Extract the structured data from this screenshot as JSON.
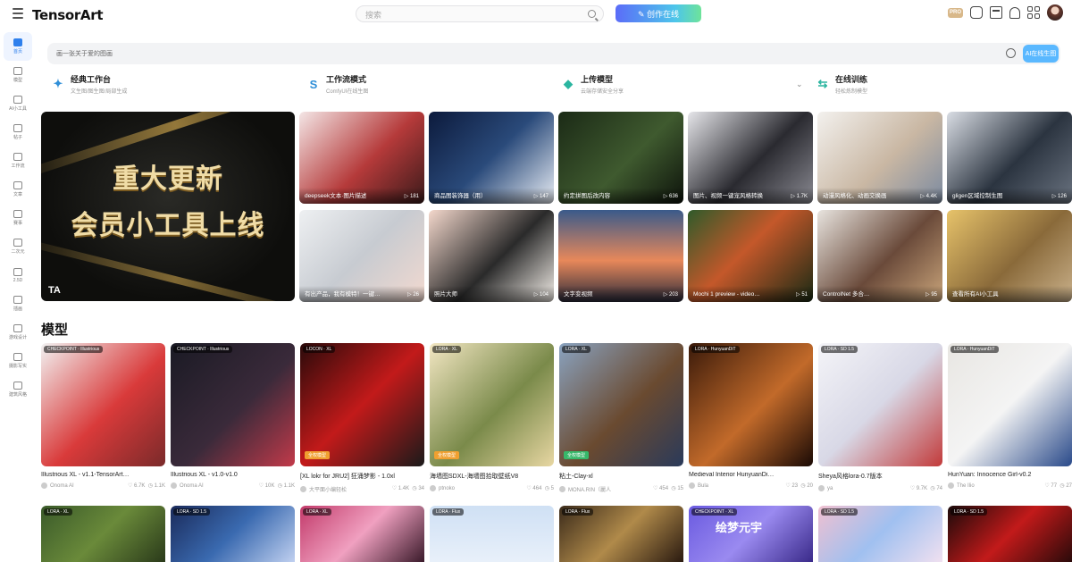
{
  "header": {
    "logo": "TensorArt",
    "search_placeholder": "搜索",
    "create_label": "✎ 创作在线",
    "pro_label": "PRO"
  },
  "sidebar": {
    "items": [
      {
        "label": "首页",
        "icon": "home-icon",
        "active": true
      },
      {
        "label": "模型",
        "icon": "model-icon"
      },
      {
        "label": "AI小工具",
        "icon": "ai-tools-icon"
      },
      {
        "label": "帖子",
        "icon": "post-icon"
      },
      {
        "label": "工作流",
        "icon": "workflow-icon"
      },
      {
        "label": "文章",
        "icon": "article-icon"
      },
      {
        "label": "赛事",
        "icon": "contest-icon"
      },
      {
        "label": "二次元",
        "icon": "anime-icon"
      },
      {
        "label": "2.5D",
        "icon": "2-5d-icon"
      },
      {
        "label": "插画",
        "icon": "illustration-icon"
      },
      {
        "label": "游戏设计",
        "icon": "game-design-icon"
      },
      {
        "label": "摄影写实",
        "icon": "photo-icon"
      },
      {
        "label": "建筑风格",
        "icon": "architecture-icon"
      }
    ]
  },
  "prompt": {
    "placeholder": "画一张关于爱的图画",
    "generate_label": "AI在线生图"
  },
  "tools": [
    {
      "title": "经典工作台",
      "sub": "文生图/图生图/局部生成",
      "icon": "wand-icon"
    },
    {
      "title": "工作流模式",
      "sub": "ComfyUI在线生图",
      "icon": "workflow-s-icon"
    },
    {
      "title": "上传模型",
      "sub": "云端存储安全分享",
      "icon": "cube-icon"
    },
    {
      "title": "在线训练",
      "sub": "轻松炼制模型",
      "icon": "arrows-icon"
    }
  ],
  "feature": {
    "line1": "重大更新",
    "line2": "会员小工具上线",
    "logo": "TA"
  },
  "gallery": [
    {
      "title": "deepseek文本·图片描述",
      "count": "▷ 181"
    },
    {
      "title": "商品图装饰器（用）",
      "count": "▷ 147"
    },
    {
      "title": "约定拼图后改内容",
      "count": "▷ 636"
    },
    {
      "title": "图片、视频一键宠风格转换",
      "count": "▷ 1.7K"
    },
    {
      "title": "动漫风格化、动画交换画",
      "count": "▷ 4.4K"
    },
    {
      "title": "gligen区域控制生图",
      "count": "▷ 126"
    },
    {
      "title": "有出产品，我有模特！一键…",
      "count": "▷ 26"
    },
    {
      "title": "照片大师",
      "count": "▷ 104"
    },
    {
      "title": "文字变视频",
      "count": "▷ 203"
    },
    {
      "title": "Mochi 1 preview - video…",
      "count": "▷ 51"
    },
    {
      "title": "ControlNet 多合…",
      "count": "▷ 95"
    },
    {
      "title": "查看所有AI小工具",
      "count": ""
    }
  ],
  "models_section": {
    "title": "模型",
    "items": [
      {
        "badge": "CHECKPOINT · Illustrious",
        "tag": "",
        "title": "Illustrious XL - v1.1-TensorArt…",
        "author": "Onoma AI",
        "stat1": "♡ 6.7K",
        "stat2": "◷ 1.1K"
      },
      {
        "badge": "CHECKPOINT · Illustrious",
        "tag": "",
        "title": "Illustrious XL - v1.0-v1.0",
        "author": "Onoma AI",
        "stat1": "♡ 10K",
        "stat2": "◷ 1.1K"
      },
      {
        "badge": "LOCON · XL",
        "tag": "全权模型",
        "title": "[XL lokr for JRU2] 狂涌梦影 - 1.0xl",
        "author": "大平面小编轻松",
        "stat1": "♡ 1.4K",
        "stat2": "◷ 34"
      },
      {
        "badge": "LORA · XL",
        "tag": "全权模型",
        "title": "海墙图SDXL-海墙图拾取壁纸V8",
        "author": "ptnoko",
        "stat1": "♡ 464",
        "stat2": "◷ 5"
      },
      {
        "badge": "LORA · XL",
        "tag": "全权模型",
        "title": "粘土-Clay-xl",
        "author": "MONA.RIN（麗人",
        "stat1": "♡ 454",
        "stat2": "◷ 15"
      },
      {
        "badge": "LORA · HunyuanDiT",
        "tag": "",
        "title": "Medieval Interior HunyuanDi…",
        "author": "Bula",
        "stat1": "♡ 23",
        "stat2": "◷ 20"
      },
      {
        "badge": "LORA · SD 1.5",
        "tag": "",
        "title": "Sheya风格lora-0.7版本",
        "author": "ya",
        "stat1": "♡ 9.7K",
        "stat2": "◷ 74"
      },
      {
        "badge": "LORA · HunyuanDiT",
        "tag": "",
        "title": "HunYuan: Innocence Girl-v0.2",
        "author": "The Ilio",
        "stat1": "♡ 77",
        "stat2": "◷ 27"
      }
    ]
  },
  "bottom_row": [
    {
      "badge": "LORA · XL"
    },
    {
      "badge": "LORA · SD 1.5"
    },
    {
      "badge": "LORA · XL"
    },
    {
      "badge": "LORA · Flux"
    },
    {
      "badge": "LORA · Flux"
    },
    {
      "badge": "CHECKPOINT · XL",
      "overlay": "绘梦元宇"
    },
    {
      "badge": "LORA · SD 1.5"
    },
    {
      "badge": "LORA · SD 1.5"
    }
  ],
  "colors": {
    "accent": "#2f80ed",
    "create_gradient_start": "#5b6cf8",
    "create_gradient_end": "#6ee39a"
  }
}
